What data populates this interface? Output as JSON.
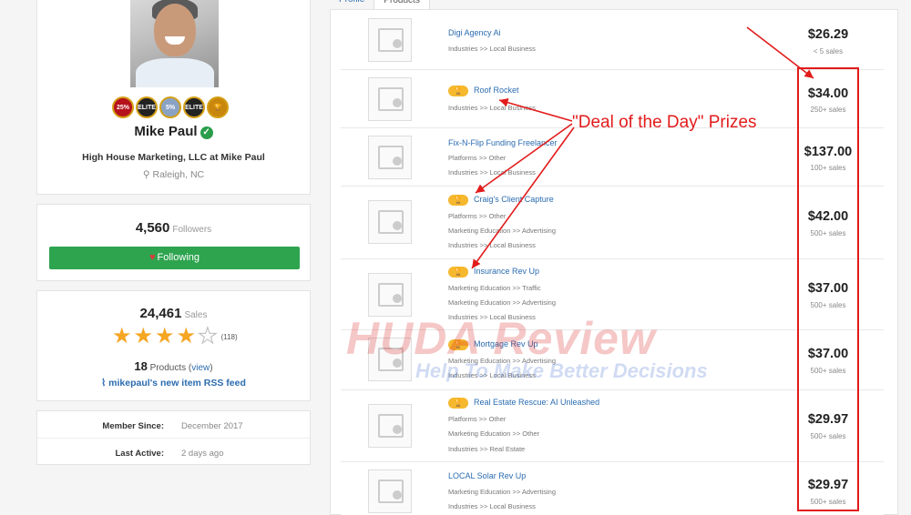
{
  "profile": {
    "name": "Mike Paul",
    "company": "High House Marketing, LLC at Mike Paul",
    "location": "Raleigh, NC",
    "badges": [
      "25%",
      "ELITE",
      "5%",
      "ELITE",
      "🏆"
    ]
  },
  "followers": {
    "count": "4,560",
    "label": "Followers",
    "button_label": "Following"
  },
  "stats": {
    "sales_count": "24,461",
    "sales_label": "Sales",
    "rating_stars": 4.5,
    "rating_count": "(118)",
    "products_count": "18",
    "products_label": "Products",
    "view_link": "view",
    "rss_label": "mikepaul's new item RSS feed"
  },
  "member": {
    "since_label": "Member Since:",
    "since_value": "December 2017",
    "active_label": "Last Active:",
    "active_value": "2 days ago"
  },
  "tabs": [
    "Profile",
    "Products"
  ],
  "products": [
    {
      "title": "Digi Agency Ai",
      "trophy": false,
      "categories": [
        "Industries >> Local Business"
      ],
      "price": "$26.29",
      "sales": "< 5 sales"
    },
    {
      "title": "Roof Rocket",
      "trophy": true,
      "categories": [
        "Industries >> Local Business"
      ],
      "price": "$34.00",
      "sales": "250+ sales"
    },
    {
      "title": "Fix-N-Flip Funding Freelancer",
      "trophy": false,
      "categories": [
        "Platforms >> Other",
        "Industries >> Local Business"
      ],
      "price": "$137.00",
      "sales": "100+ sales"
    },
    {
      "title": "Craig's Client Capture",
      "trophy": true,
      "categories": [
        "Platforms >> Other",
        "Marketing Education >> Advertising",
        "Industries >> Local Business"
      ],
      "price": "$42.00",
      "sales": "500+ sales"
    },
    {
      "title": "Insurance Rev Up",
      "trophy": true,
      "categories": [
        "Marketing Education >> Traffic",
        "Marketing Education >> Advertising",
        "Industries >> Local Business"
      ],
      "price": "$37.00",
      "sales": "500+ sales"
    },
    {
      "title": "Mortgage Rev Up",
      "trophy": true,
      "categories": [
        "Marketing Education >> Advertising",
        "Industries >> Local Business"
      ],
      "price": "$37.00",
      "sales": "500+ sales"
    },
    {
      "title": "Real Estate Rescue: AI Unleashed",
      "trophy": true,
      "categories": [
        "Platforms >> Other",
        "Marketing Education >> Other",
        "Industries >> Real Estate"
      ],
      "price": "$29.97",
      "sales": "500+ sales"
    },
    {
      "title": "LOCAL Solar Rev Up",
      "trophy": false,
      "categories": [
        "Marketing Education >> Advertising",
        "Industries >> Local Business"
      ],
      "price": "$29.97",
      "sales": "500+ sales"
    }
  ],
  "annotation": {
    "label": "\"Deal of the Day\" Prizes",
    "color": "#e21b1b"
  },
  "watermark": {
    "line1": "HUDA Review",
    "line2": "Help To Make Better Decisions"
  }
}
